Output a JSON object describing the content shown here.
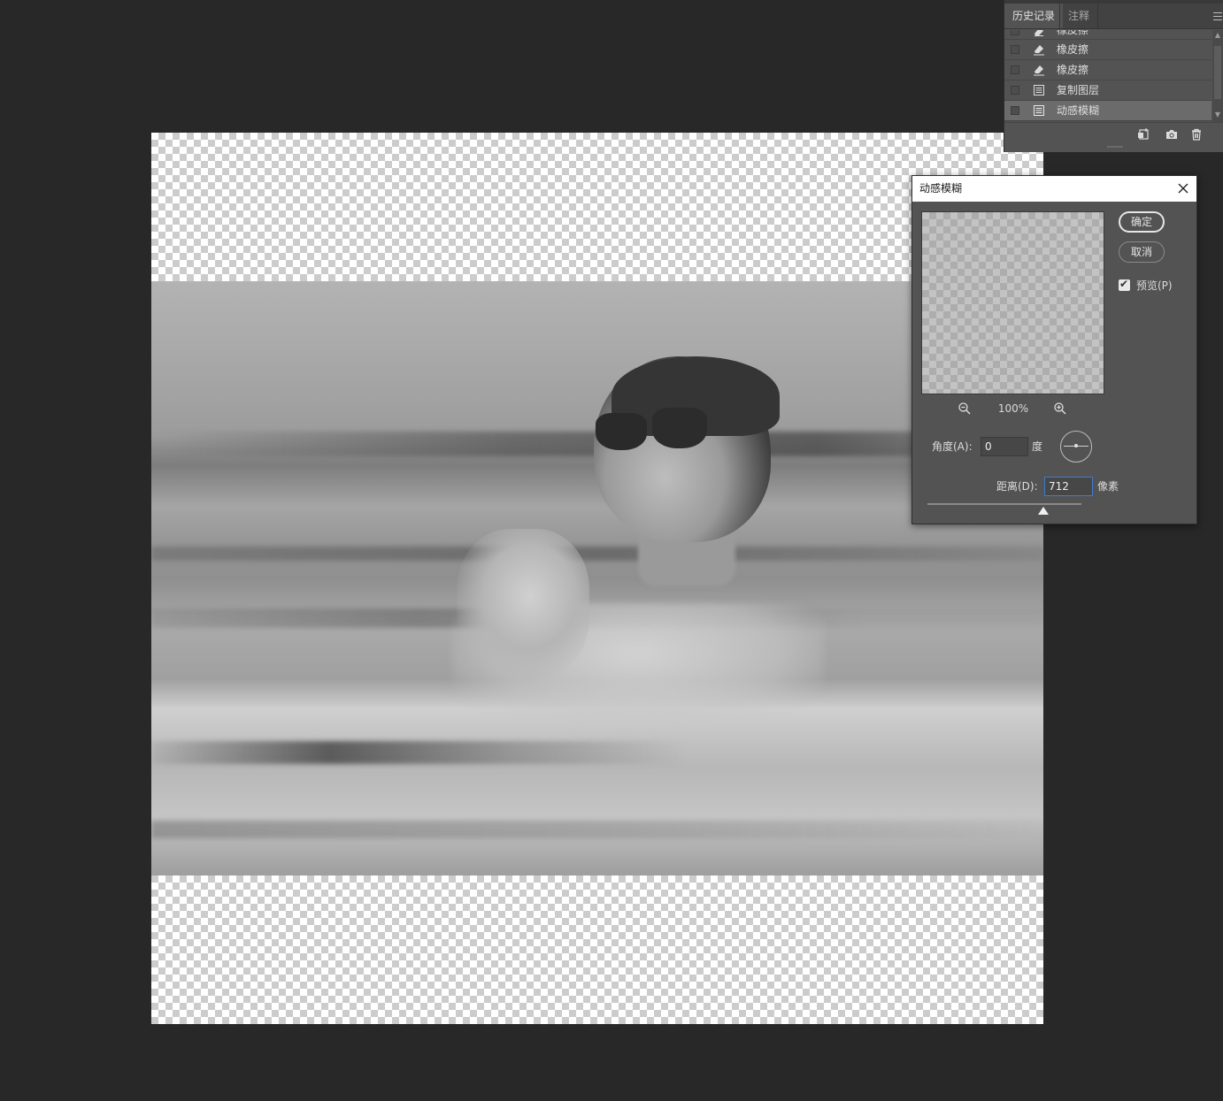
{
  "history_panel": {
    "tabs": [
      {
        "label": "历史记录",
        "active": true
      },
      {
        "label": "注释",
        "active": false
      }
    ],
    "items": [
      {
        "label": "橡皮擦",
        "icon": "eraser-icon",
        "partial": true
      },
      {
        "label": "橡皮擦",
        "icon": "eraser-icon"
      },
      {
        "label": "橡皮擦",
        "icon": "eraser-icon"
      },
      {
        "label": "复制图层",
        "icon": "document-icon"
      },
      {
        "label": "动感模糊",
        "icon": "document-icon",
        "selected": true
      }
    ],
    "footer_icons": [
      "new-document-from-state-icon",
      "camera-snapshot-icon",
      "trash-icon"
    ]
  },
  "dialog": {
    "title": "动感模糊",
    "ok_label": "确定",
    "cancel_label": "取消",
    "preview_label": "预览(P)",
    "preview_checked": true,
    "zoom_level": "100%",
    "angle_label": "角度(A):",
    "angle_value": "0",
    "angle_unit": "度",
    "distance_label": "距离(D):",
    "distance_value": "712",
    "distance_unit": "像素",
    "distance_slider_fraction": 0.75
  },
  "colors": {
    "workspace_bg": "#282828",
    "panel_bg": "#535353",
    "selected_row": "#6b6b6b",
    "focus_border": "#3f7ad4"
  }
}
